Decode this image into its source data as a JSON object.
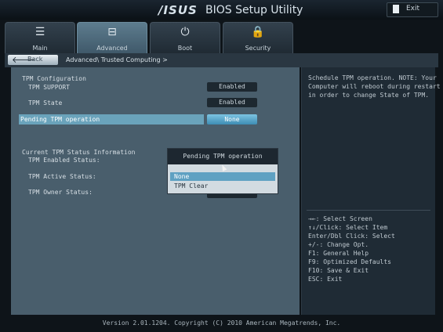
{
  "header": {
    "logo": "/ISUS",
    "title": "BIOS Setup Utility",
    "exit_label": "Exit"
  },
  "tabs": [
    {
      "label": "Main",
      "icon": "list-icon"
    },
    {
      "label": "Advanced",
      "icon": "advanced-icon",
      "active": true
    },
    {
      "label": "Boot",
      "icon": "power-icon"
    },
    {
      "label": "Security",
      "icon": "lock-icon"
    }
  ],
  "breadcrumb": {
    "back_label": "Back",
    "path": "Advanced\\ Trusted Computing >"
  },
  "settings": {
    "section_title": "TPM Configuration",
    "tpm_support_label": "TPM SUPPORT",
    "tpm_support_value": "Enabled",
    "tpm_state_label": "TPM State",
    "tpm_state_value": "Enabled",
    "pending_label": "Pending TPM operation",
    "pending_value": "None"
  },
  "status": {
    "section_title": "Current TPM Status Information",
    "enabled_label": "TPM Enabled Status:",
    "active_label": "TPM Active Status:",
    "owner_label": "TPM Owner Status:"
  },
  "popup": {
    "title": "Pending TPM operation",
    "options": [
      "None",
      "TPM Clear"
    ],
    "selected": "None"
  },
  "help": {
    "text": "Schedule TPM operation. NOTE: Your\nComputer will reboot during restart\nin order to change State of TPM."
  },
  "keys": [
    "→←: Select Screen",
    "↑↓/Click: Select Item",
    "Enter/Dbl Click: Select",
    "+/-: Change Opt.",
    "F1: General Help",
    "F9: Optimized Defaults",
    "F10: Save & Exit",
    "ESC: Exit"
  ],
  "footer": "Version 2.01.1204. Copyright (C) 2010 American Megatrends, Inc."
}
